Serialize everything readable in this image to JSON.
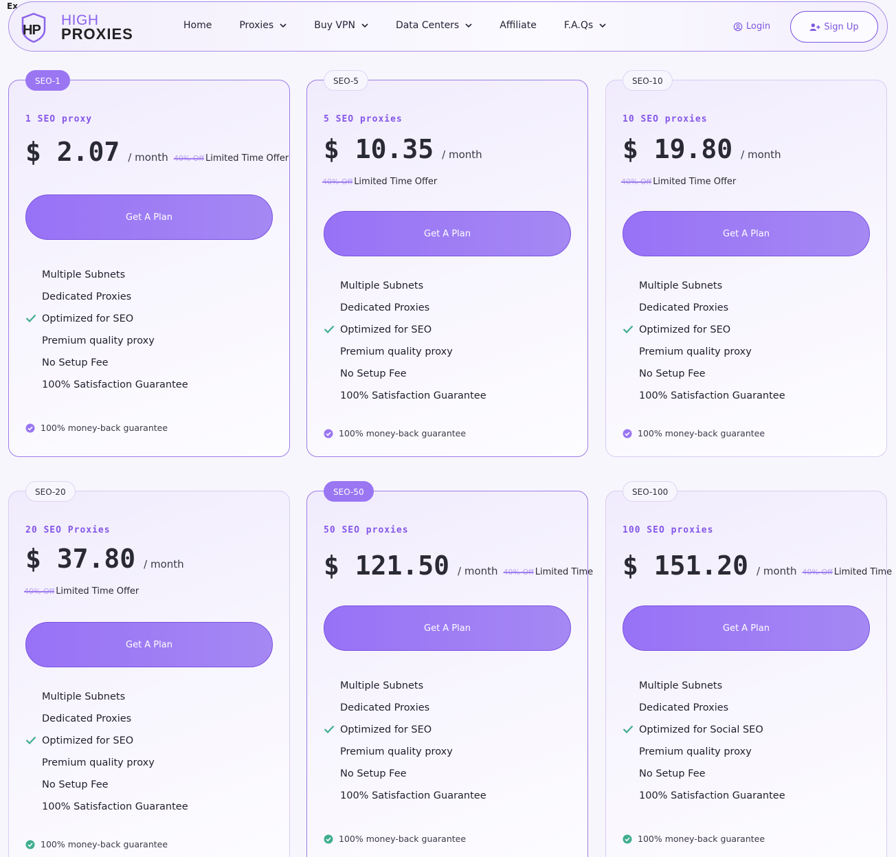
{
  "corner_text": "Ex",
  "header": {
    "logo": {
      "mark": "HP",
      "word_top": "HIGH",
      "word_bottom": "PROXIES"
    },
    "nav": [
      {
        "label": "Home",
        "dropdown": false
      },
      {
        "label": "Proxies",
        "dropdown": true
      },
      {
        "label": "Buy VPN",
        "dropdown": true
      },
      {
        "label": "Data Centers",
        "dropdown": true
      },
      {
        "label": "Affiliate",
        "dropdown": false
      },
      {
        "label": "F.A.Qs",
        "dropdown": true
      }
    ],
    "login_label": "Login",
    "signup_label": "Sign Up"
  },
  "colors": {
    "accent": "#8456e8",
    "button": "#9872f6",
    "check_green": "#3fae8f"
  },
  "plans": [
    {
      "badge": "SEO-1",
      "title": "1 SEO proxy",
      "price": "$ 2.07",
      "period": "/ month",
      "discount": "40% Off",
      "offer": "Limited Time Offer",
      "button": "Get A Plan",
      "features": [
        "Multiple Subnets",
        "Dedicated Proxies",
        "Optimized for SEO",
        "Premium quality proxy",
        "No Setup Fee",
        "100% Satisfaction Guarantee"
      ],
      "guarantee": "100% money-back guarantee"
    },
    {
      "badge": "SEO-5",
      "title": "5 SEO proxies",
      "price": "$ 10.35",
      "period": "/ month",
      "discount": "40% Off",
      "offer": "Limited Time Offer",
      "button": "Get A Plan",
      "features": [
        "Multiple Subnets",
        "Dedicated Proxies",
        "Optimized for SEO",
        "Premium quality proxy",
        "No Setup Fee",
        "100% Satisfaction Guarantee"
      ],
      "guarantee": "100% money-back guarantee"
    },
    {
      "badge": "SEO-10",
      "title": "10 SEO proxies",
      "price": "$ 19.80",
      "period": "/ month",
      "discount": "40% Off",
      "offer": "Limited Time Offer",
      "button": "Get A Plan",
      "features": [
        "Multiple Subnets",
        "Dedicated Proxies",
        "Optimized for SEO",
        "Premium quality proxy",
        "No Setup Fee",
        "100% Satisfaction Guarantee"
      ],
      "guarantee": "100% money-back guarantee"
    },
    {
      "badge": "SEO-20",
      "title": "20 SEO Proxies",
      "price": "$ 37.80",
      "period": "/ month",
      "discount": "40% Off",
      "offer": "Limited Time Offer",
      "button": "Get A Plan",
      "features": [
        "Multiple Subnets",
        "Dedicated Proxies",
        "Optimized for SEO",
        "Premium quality proxy",
        "No Setup Fee",
        "100% Satisfaction Guarantee"
      ],
      "guarantee": "100% money-back guarantee"
    },
    {
      "badge": "SEO-50",
      "title": "50 SEO proxies",
      "price": "$ 121.50",
      "period": "/ month",
      "discount": "40% Off",
      "offer": "Limited Time",
      "button": "Get A Plan",
      "features": [
        "Multiple Subnets",
        "Dedicated Proxies",
        "Optimized for SEO",
        "Premium quality proxy",
        "No Setup Fee",
        "100% Satisfaction Guarantee"
      ],
      "guarantee": "100% money-back guarantee"
    },
    {
      "badge": "SEO-100",
      "title": "100 SEO proxies",
      "price": "$ 151.20",
      "period": "/ month",
      "discount": "40% Off",
      "offer": "Limited Time",
      "button": "Get A Plan",
      "features": [
        "Multiple Subnets",
        "Dedicated Proxies",
        "Optimized for Social SEO",
        "Premium quality proxy",
        "No Setup Fee",
        "100% Satisfaction Guarantee"
      ],
      "guarantee": "100% money-back guarantee"
    }
  ]
}
